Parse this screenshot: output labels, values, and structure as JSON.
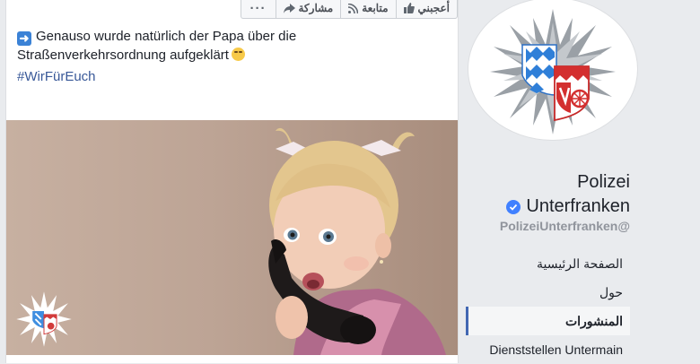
{
  "post": {
    "actions": {
      "like": "أعجبني",
      "follow": "متابعة",
      "share": "مشاركة",
      "more": "···"
    },
    "text_line1": "Genauso wurde natürlich der Papa über die",
    "text_line2": "Straßenverkehrsordnung aufgeklärt",
    "hashtag": "#WirFürEuch",
    "icons": [
      "arrow-right-emoji",
      "smile-emoji",
      "like-icon",
      "rss-icon",
      "share-icon"
    ]
  },
  "page": {
    "name_line1": "Polizei",
    "name_line2": "Unterfranken",
    "handle": "PolizeiUnterfranken@",
    "verified_color": "#4080ff"
  },
  "nav": {
    "home": "الصفحة الرئيسية",
    "about": "حول",
    "posts": "المنشورات",
    "stations": "Dienststellen Untermain"
  },
  "colors": {
    "link": "#385898",
    "accent": "#4267b2",
    "text": "#1d2129",
    "muted": "#90949c"
  }
}
